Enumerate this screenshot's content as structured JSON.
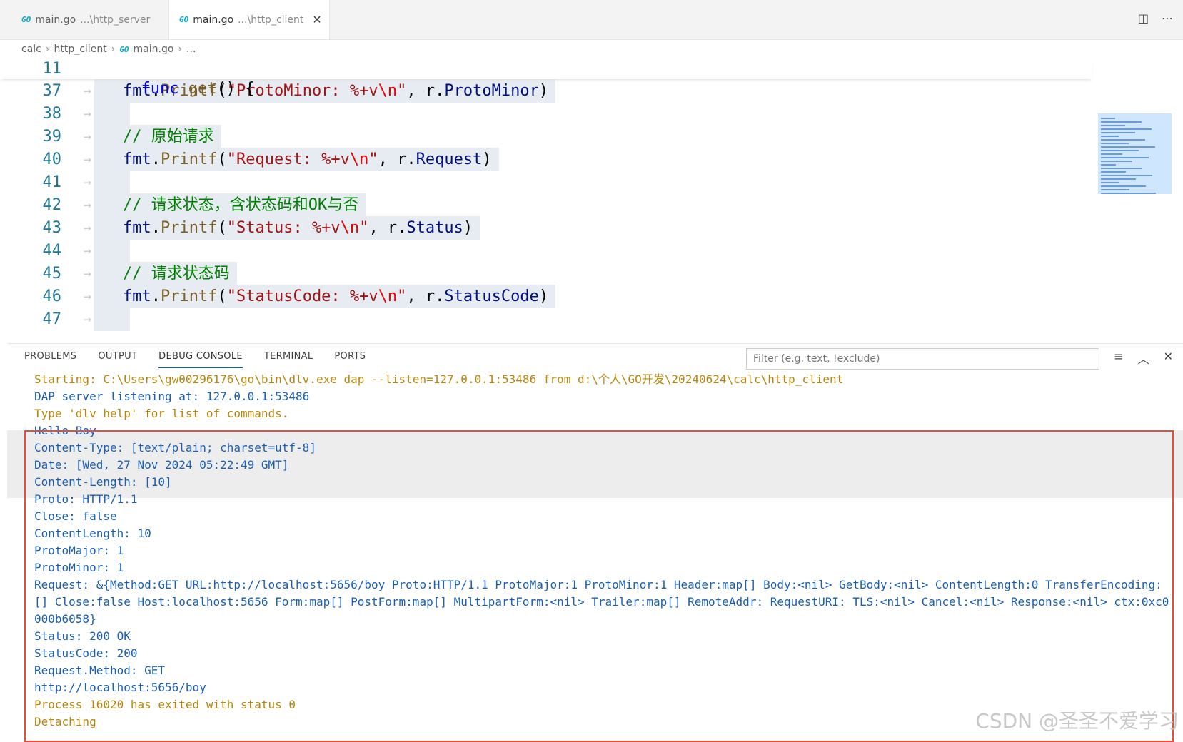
{
  "tabs": [
    {
      "file": "main.go",
      "dir": "...\\http_server",
      "active": false
    },
    {
      "file": "main.go",
      "dir": "...\\http_client",
      "active": true
    }
  ],
  "tab_badge": "GO",
  "breadcrumb": [
    "calc",
    "http_client",
    "main.go",
    "..."
  ],
  "sticky": {
    "number": "11",
    "code": "func get() {"
  },
  "code_lines": [
    {
      "n": "37",
      "parts": [
        [
          "fmt",
          "var"
        ],
        [
          ".",
          "plain"
        ],
        [
          "Printf",
          "fn"
        ],
        [
          "(",
          "plain"
        ],
        [
          "\"ProtoMinor: %+v",
          "str"
        ],
        [
          "\\n",
          "esc"
        ],
        [
          "\"",
          "str"
        ],
        [
          ", r.",
          "plain"
        ],
        [
          "ProtoMinor",
          "var"
        ],
        [
          ")",
          "plain"
        ]
      ],
      "highlight": true
    },
    {
      "n": "38",
      "parts": [],
      "highlight": true
    },
    {
      "n": "39",
      "parts": [
        [
          "// 原始请求",
          "cmt"
        ]
      ],
      "highlight": true
    },
    {
      "n": "40",
      "parts": [
        [
          "fmt",
          "var"
        ],
        [
          ".",
          "plain"
        ],
        [
          "Printf",
          "fn"
        ],
        [
          "(",
          "plain"
        ],
        [
          "\"Request: %+v",
          "str"
        ],
        [
          "\\n",
          "esc"
        ],
        [
          "\"",
          "str"
        ],
        [
          ", r.",
          "plain"
        ],
        [
          "Request",
          "var"
        ],
        [
          ")",
          "plain"
        ]
      ],
      "highlight": true
    },
    {
      "n": "41",
      "parts": [],
      "highlight": true
    },
    {
      "n": "42",
      "parts": [
        [
          "// 请求状态，含状态码和OK与否",
          "cmt"
        ]
      ],
      "highlight": true
    },
    {
      "n": "43",
      "parts": [
        [
          "fmt",
          "var"
        ],
        [
          ".",
          "plain"
        ],
        [
          "Printf",
          "fn"
        ],
        [
          "(",
          "plain"
        ],
        [
          "\"Status: %+v",
          "str"
        ],
        [
          "\\n",
          "esc"
        ],
        [
          "\"",
          "str"
        ],
        [
          ", r.",
          "plain"
        ],
        [
          "Status",
          "var"
        ],
        [
          ")",
          "plain"
        ]
      ],
      "highlight": true
    },
    {
      "n": "44",
      "parts": [],
      "highlight": true
    },
    {
      "n": "45",
      "parts": [
        [
          "// 请求状态码",
          "cmt"
        ]
      ],
      "highlight": true
    },
    {
      "n": "46",
      "parts": [
        [
          "fmt",
          "var"
        ],
        [
          ".",
          "plain"
        ],
        [
          "Printf",
          "fn"
        ],
        [
          "(",
          "plain"
        ],
        [
          "\"StatusCode: %+v",
          "str"
        ],
        [
          "\\n",
          "esc"
        ],
        [
          "\"",
          "str"
        ],
        [
          ", r.",
          "plain"
        ],
        [
          "StatusCode",
          "var"
        ],
        [
          ")",
          "plain"
        ]
      ],
      "highlight": true
    },
    {
      "n": "47",
      "parts": [],
      "highlight": true
    }
  ],
  "panel": {
    "tabs": [
      "PROBLEMS",
      "OUTPUT",
      "DEBUG CONSOLE",
      "TERMINAL",
      "PORTS"
    ],
    "active_tab": "DEBUG CONSOLE",
    "filter_placeholder": "Filter (e.g. text, !exclude)"
  },
  "console_lines": [
    {
      "text": "Starting: C:\\Users\\gw00296176\\go\\bin\\dlv.exe dap --listen=127.0.0.1:53486 from d:\\个人\\GO开发\\20240624\\calc\\http_client",
      "color": "orange"
    },
    {
      "text": "DAP server listening at: 127.0.0.1:53486",
      "color": "blue"
    },
    {
      "text": "Type 'dlv help' for list of commands.",
      "color": "orange"
    },
    {
      "text": "Hello Boy",
      "color": "blue"
    },
    {
      "text": "Content-Type: [text/plain; charset=utf-8]",
      "color": "blue"
    },
    {
      "text": "Date: [Wed, 27 Nov 2024 05:22:49 GMT]",
      "color": "blue"
    },
    {
      "text": "Content-Length: [10]",
      "color": "blue"
    },
    {
      "text": "Proto: HTTP/1.1",
      "color": "blue"
    },
    {
      "text": "Close: false",
      "color": "blue"
    },
    {
      "text": "ContentLength: 10",
      "color": "blue"
    },
    {
      "text": "ProtoMajor: 1",
      "color": "blue"
    },
    {
      "text": "ProtoMinor: 1",
      "color": "blue"
    },
    {
      "text": "Request: &{Method:GET URL:http://localhost:5656/boy Proto:HTTP/1.1 ProtoMajor:1 ProtoMinor:1 Header:map[] Body:<nil> GetBody:<nil> ContentLength:0 TransferEncoding:",
      "color": "blue"
    },
    {
      "text": "[] Close:false Host:localhost:5656 Form:map[] PostForm:map[] MultipartForm:<nil> Trailer:map[] RemoteAddr: RequestURI: TLS:<nil> Cancel:<nil> Response:<nil> ctx:0xc0",
      "color": "blue"
    },
    {
      "text": "000b6058}",
      "color": "blue"
    },
    {
      "text": "Status: 200 OK",
      "color": "blue"
    },
    {
      "text": "StatusCode: 200",
      "color": "blue"
    },
    {
      "text": "Request.Method: GET",
      "color": "blue"
    },
    {
      "text": "http://localhost:5656/boy",
      "color": "blue"
    },
    {
      "text": "Process 16020 has exited with status 0",
      "color": "orange"
    },
    {
      "text": "Detaching",
      "color": "orange"
    }
  ],
  "watermark": "CSDN @圣圣不爱学习",
  "icons": {
    "tab_close": "close-icon",
    "split_editor": "split-editor-icon",
    "more_actions": "more-icon",
    "filter_list": "list-filter-icon",
    "maximize_panel": "chevron-up-icon",
    "close_panel": "close-icon"
  }
}
